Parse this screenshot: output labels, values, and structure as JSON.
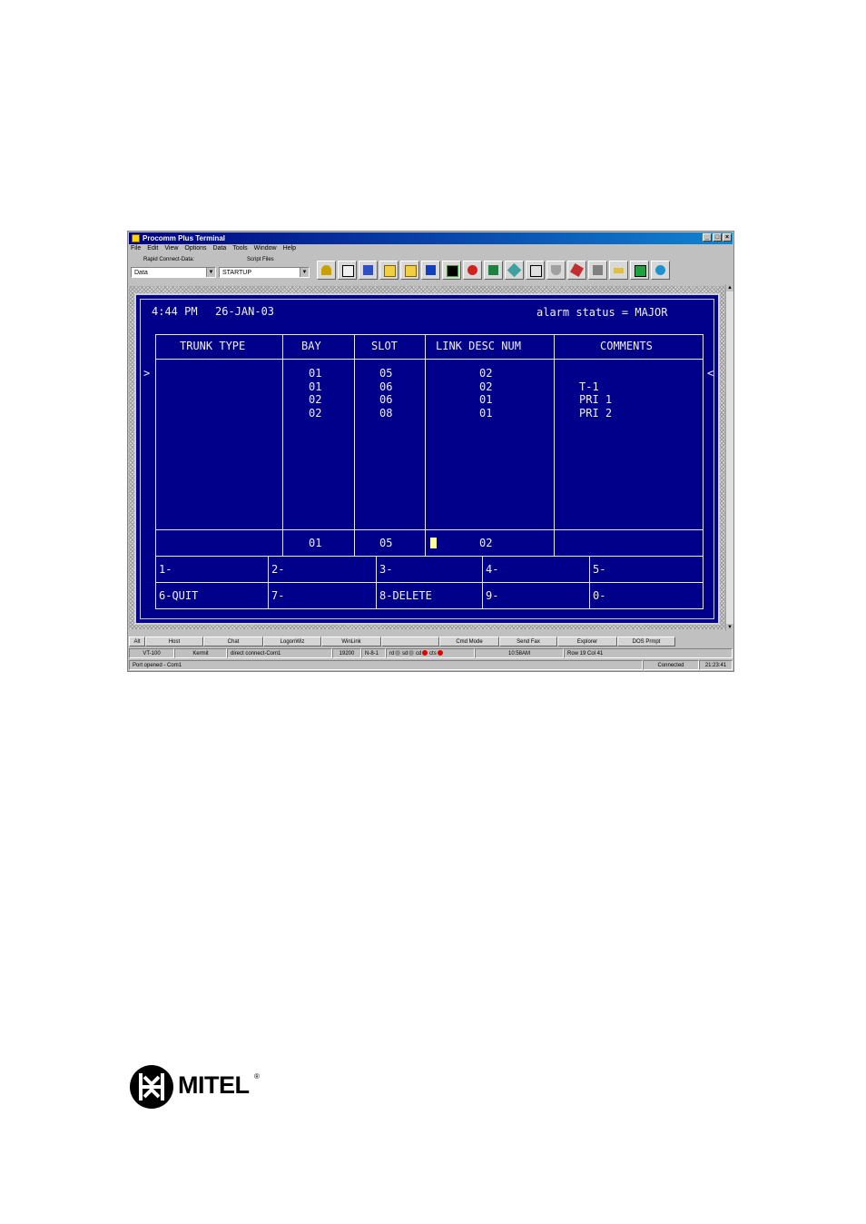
{
  "window": {
    "title": "Procomm Plus Terminal",
    "controls": [
      "_",
      "□",
      "×"
    ]
  },
  "menu": [
    "File",
    "Edit",
    "View",
    "Options",
    "Data",
    "Tools",
    "Window",
    "Help"
  ],
  "toolbar": {
    "rapid_connect_label": "Rapid Connect-Data:",
    "rapid_connect_value": "Data",
    "script_files_label": "Script Files",
    "script_files_value": "STARTUP"
  },
  "terminal": {
    "time": "4:44 PM",
    "date": "26-JAN-03",
    "alarm_label": "alarm status = MAJOR",
    "headers": [
      "TRUNK TYPE",
      "BAY",
      "SLOT",
      "LINK DESC NUM",
      "COMMENTS"
    ],
    "rows": [
      {
        "bay": "01",
        "slot": "05",
        "link": "02",
        "comment": ""
      },
      {
        "bay": "01",
        "slot": "06",
        "link": "02",
        "comment": "T-1"
      },
      {
        "bay": "02",
        "slot": "06",
        "link": "01",
        "comment": "PRI 1"
      },
      {
        "bay": "02",
        "slot": "08",
        "link": "01",
        "comment": "PRI 2"
      }
    ],
    "input_row": {
      "bay": "01",
      "slot": "05",
      "link": "02"
    },
    "left_arrow": ">",
    "right_arrow": "<",
    "softkeys_top": [
      "1-",
      "2-",
      "3-",
      "4-",
      "5-"
    ],
    "softkeys_bottom": [
      "6-QUIT",
      "7-",
      "8-DELETE",
      "9-",
      "0-"
    ]
  },
  "button_bar": [
    "Alt",
    "Host",
    "Chat",
    "LogonWiz",
    "WinLink",
    "",
    "Cmd Mode",
    "Send Fax",
    "Explorer",
    "DOS Prmpt"
  ],
  "status": {
    "emulation": "VT-100",
    "protocol": "Kermit",
    "connection": "direct connect-Com1",
    "baud": "19200",
    "settings": "N-8-1",
    "rd": "rd",
    "sd": "sd",
    "cd": "cd",
    "cts": "cts",
    "clock": "10:58AM",
    "row_col": "Row 19   Col 41"
  },
  "status2": {
    "message": "Port opened - Com1",
    "state": "Connected",
    "elapsed": "21:23:41"
  },
  "logo": {
    "text": "MITEL",
    "mark": "®"
  }
}
